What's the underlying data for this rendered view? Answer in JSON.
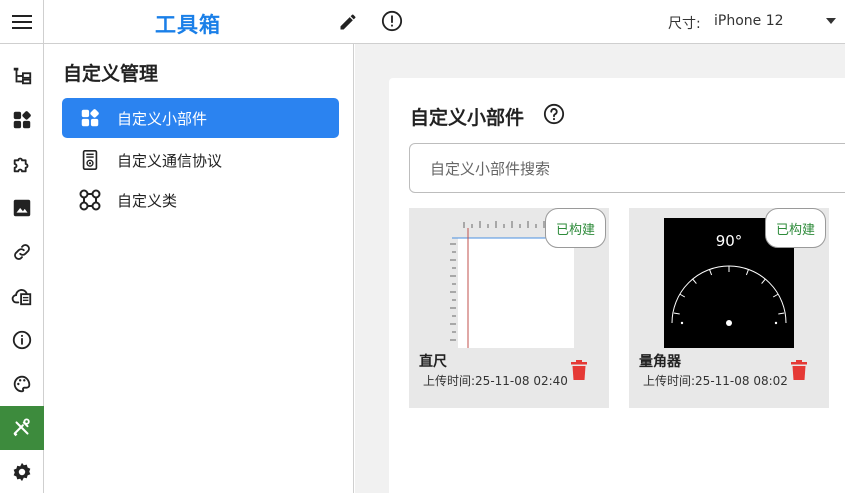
{
  "header": {
    "title": "工具箱",
    "size_label": "尺寸:",
    "size_value": "iPhone 12"
  },
  "rail": {
    "items": [
      {
        "icon": "tree-structure-icon"
      },
      {
        "icon": "widgets-icon"
      },
      {
        "icon": "puzzle-icon"
      },
      {
        "icon": "image-icon"
      },
      {
        "icon": "link-icon"
      },
      {
        "icon": "cloud-list-icon"
      },
      {
        "icon": "info-icon"
      },
      {
        "icon": "palette-icon"
      },
      {
        "icon": "tools-icon",
        "active": true
      },
      {
        "icon": "gear-icon"
      }
    ],
    "active_color": "#3d8b3d"
  },
  "sidebar": {
    "title": "自定义管理",
    "items": [
      {
        "label": "自定义小部件",
        "icon": "widgets-icon",
        "active": true
      },
      {
        "label": "自定义通信协议",
        "icon": "protocol-document-icon"
      },
      {
        "label": "自定义类",
        "icon": "class-nodes-icon"
      }
    ],
    "active_color": "#2b83f0"
  },
  "main": {
    "title": "自定义小部件",
    "search_placeholder": "自定义小部件搜索",
    "search_value": "",
    "widgets": [
      {
        "name": "直尺",
        "time": "上传时间:25-11-08 02:40",
        "badge": "已构建"
      },
      {
        "name": "量角器",
        "time": "上传时间:25-11-08 08:02",
        "badge": "已构建",
        "angle": "90°"
      }
    ],
    "badge_color": "#2e8b3a",
    "delete_color": "#e53935"
  }
}
